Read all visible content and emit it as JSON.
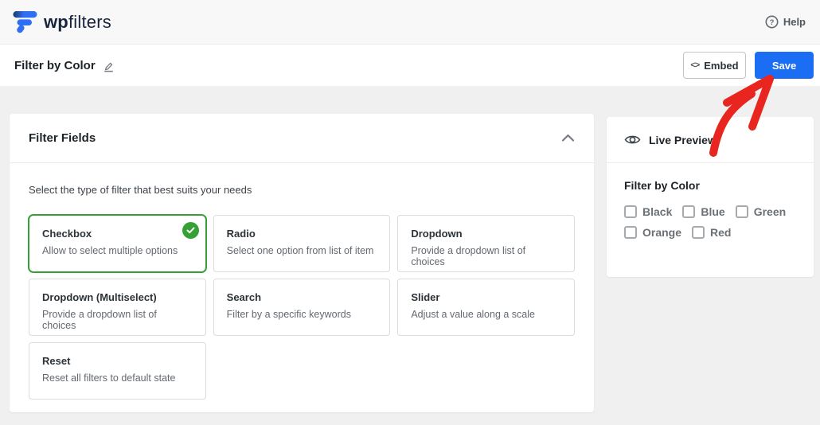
{
  "header": {
    "logo_bold": "wp",
    "logo_light": "filters",
    "help_label": "Help"
  },
  "toolbar": {
    "page_title": "Filter by Color",
    "embed_label": "Embed",
    "embed_icon_glyph": "<>",
    "save_label": "Save"
  },
  "filter_fields": {
    "title": "Filter Fields",
    "subtitle": "Select the type of filter that best suits your needs",
    "cards": [
      {
        "title": "Checkbox",
        "description": "Allow to select multiple options",
        "selected": true
      },
      {
        "title": "Radio",
        "description": "Select one option from list of item",
        "selected": false
      },
      {
        "title": "Dropdown",
        "description": "Provide a dropdown list of choices",
        "selected": false
      },
      {
        "title": "Dropdown (Multiselect)",
        "description": "Provide a dropdown list of choices",
        "selected": false
      },
      {
        "title": "Search",
        "description": "Filter by a specific keywords",
        "selected": false
      },
      {
        "title": "Slider",
        "description": "Adjust a value along a scale",
        "selected": false
      },
      {
        "title": "Reset",
        "description": "Reset all filters to default state",
        "selected": false
      }
    ]
  },
  "live_preview": {
    "title": "Live Preview",
    "heading": "Filter by Color",
    "options": [
      {
        "label": "Black",
        "checked": false
      },
      {
        "label": "Blue",
        "checked": false
      },
      {
        "label": "Green",
        "checked": false
      },
      {
        "label": "Orange",
        "checked": false
      },
      {
        "label": "Red",
        "checked": false
      }
    ]
  },
  "colors": {
    "accent_blue": "#1b6ef3",
    "selected_green": "#35a035",
    "arrow_red": "#e8251f",
    "page_background": "#f0f0f1"
  }
}
